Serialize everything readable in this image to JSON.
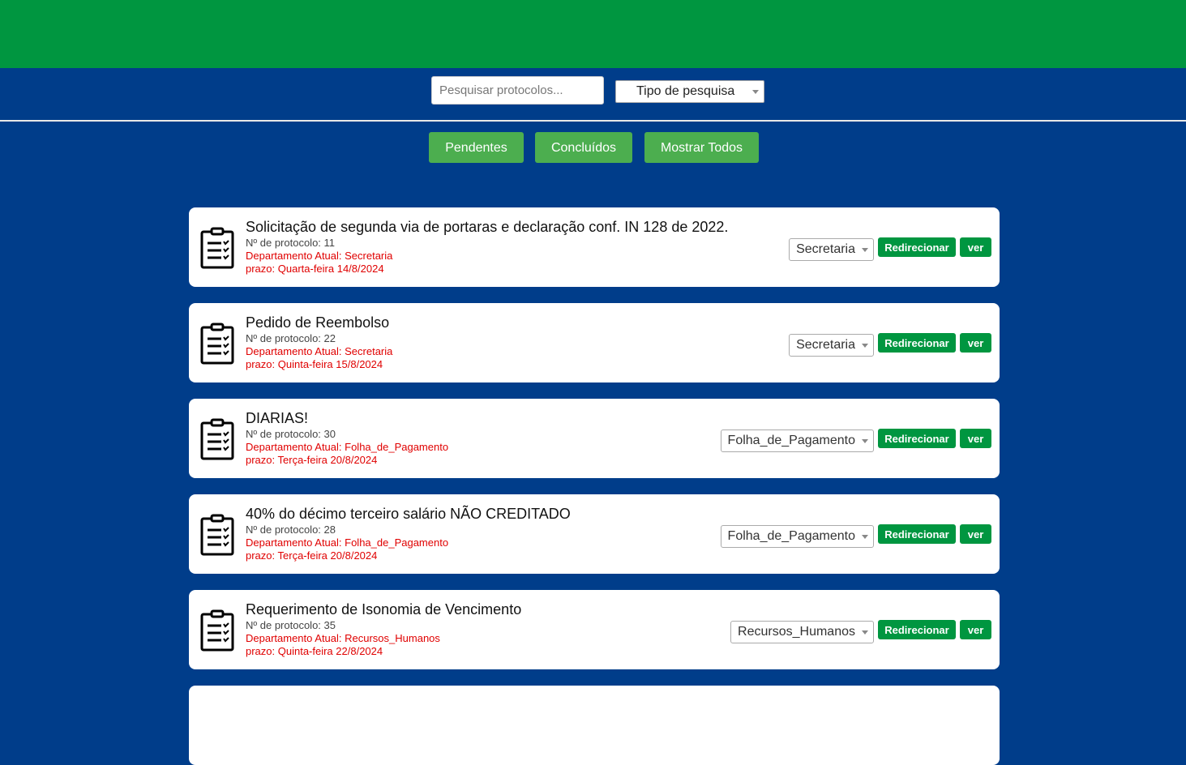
{
  "search": {
    "placeholder": "Pesquisar protocolos...",
    "type_label": "Tipo de pesquisa"
  },
  "filters": {
    "pending": "Pendentes",
    "completed": "Concluídos",
    "show_all": "Mostrar Todos"
  },
  "actions": {
    "redirect_label": "Redirecionar",
    "view_label": "ver"
  },
  "colors": {
    "header_green": "#009640",
    "background_blue": "#003d8a",
    "filter_button": "#4cae4f",
    "action_button": "#009640",
    "alert_text": "#e00000"
  },
  "protocols": [
    {
      "title": "Solicitação de segunda via de portaras e declaração conf. IN 128 de 2022.",
      "number": "Nº de protocolo: 11",
      "department": "Departamento Atual: Secretaria",
      "deadline": "prazo: Quarta-feira 14/8/2024",
      "select_value": "Secretaria",
      "icon": "clipboard-checklist-icon"
    },
    {
      "title": "Pedido de Reembolso",
      "number": "Nº de protocolo: 22",
      "department": "Departamento Atual: Secretaria",
      "deadline": "prazo: Quinta-feira 15/8/2024",
      "select_value": "Secretaria",
      "icon": "clipboard-checklist-icon"
    },
    {
      "title": "DIARIAS!",
      "number": "Nº de protocolo: 30",
      "department": "Departamento Atual: Folha_de_Pagamento",
      "deadline": "prazo: Terça-feira 20/8/2024",
      "select_value": "Folha_de_Pagamento",
      "icon": "clipboard-checklist-icon"
    },
    {
      "title": "40% do décimo terceiro salário NÃO CREDITADO",
      "number": "Nº de protocolo: 28",
      "department": "Departamento Atual: Folha_de_Pagamento",
      "deadline": "prazo: Terça-feira 20/8/2024",
      "select_value": "Folha_de_Pagamento",
      "icon": "clipboard-checklist-icon"
    },
    {
      "title": "Requerimento de Isonomia de Vencimento",
      "number": "Nº de protocolo: 35",
      "department": "Departamento Atual: Recursos_Humanos",
      "deadline": "prazo: Quinta-feira 22/8/2024",
      "select_value": "Recursos_Humanos",
      "icon": "clipboard-checklist-icon"
    }
  ]
}
